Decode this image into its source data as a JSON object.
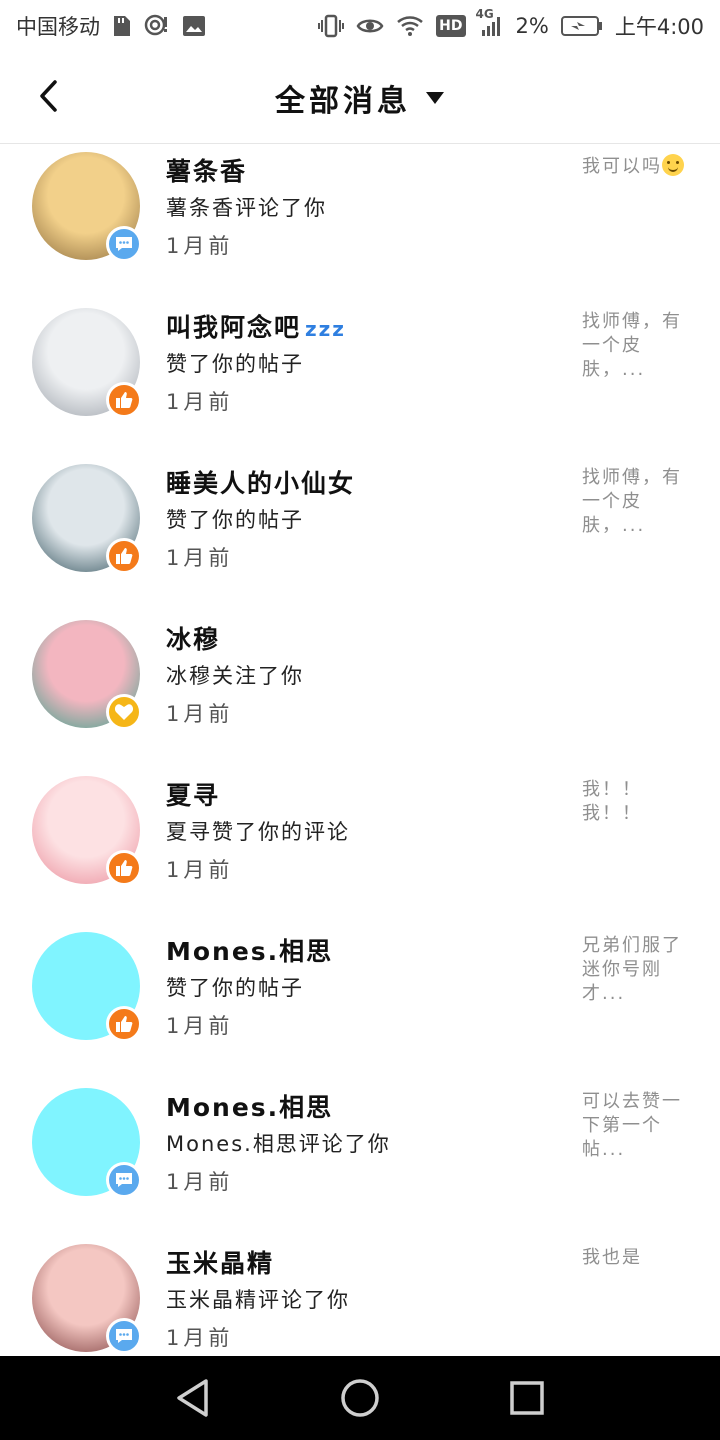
{
  "status_bar": {
    "carrier": "中国移动",
    "battery": "2%",
    "time": "上午4:00",
    "network": "4G",
    "hd": "HD",
    "icons": [
      "sim-card-icon",
      "hotspot-icon",
      "image-icon",
      "vibrate-icon",
      "eye-icon",
      "wifi-icon",
      "signal-icon",
      "battery-charging-icon"
    ]
  },
  "header": {
    "title": "全部消息",
    "back_icon": "chevron-left-icon",
    "dropdown_icon": "caret-down-icon"
  },
  "messages": [
    {
      "name": "薯条香",
      "name_suffix": "",
      "action": "薯条香评论了你",
      "time": "1月前",
      "preview": "我可以吗",
      "preview_emoji": true,
      "badge": "comment",
      "avatar_colors": [
        "#f2d08a",
        "#8a6a3a"
      ]
    },
    {
      "name": "叫我阿念吧",
      "name_suffix": "zzz",
      "action": "赞了你的帖子",
      "time": "1月前",
      "preview": "找师傅，有一个皮肤，...",
      "preview_emoji": false,
      "badge": "like",
      "avatar_colors": [
        "#eef0f2",
        "#9aa0a8"
      ]
    },
    {
      "name": "睡美人的小仙女",
      "name_suffix": "",
      "action": "赞了你的帖子",
      "time": "1月前",
      "preview": "找师傅，有一个皮肤，...",
      "preview_emoji": false,
      "badge": "like",
      "avatar_colors": [
        "#dfe6ea",
        "#2f4f5a"
      ]
    },
    {
      "name": "冰穆",
      "name_suffix": "",
      "action": "冰穆关注了你",
      "time": "1月前",
      "preview": "",
      "preview_emoji": false,
      "badge": "follow",
      "avatar_colors": [
        "#f3b6c0",
        "#3aa08a"
      ]
    },
    {
      "name": "夏寻",
      "name_suffix": "",
      "action": "夏寻赞了你的评论",
      "time": "1月前",
      "preview": "我！！我！！",
      "preview_emoji": false,
      "badge": "like",
      "avatar_colors": [
        "#fde1e3",
        "#e98a98"
      ]
    },
    {
      "name": "Mones.相思",
      "name_suffix": "",
      "action": "赞了你的帖子",
      "time": "1月前",
      "preview": "兄弟们服了迷你号刚才...",
      "preview_emoji": false,
      "badge": "like",
      "avatar_colors": [
        "#80f4ff",
        "#80f4ff"
      ]
    },
    {
      "name": "Mones.相思",
      "name_suffix": "",
      "action": "Mones.相思评论了你",
      "time": "1月前",
      "preview": "可以去赞一下第一个帖...",
      "preview_emoji": false,
      "badge": "comment",
      "avatar_colors": [
        "#80f4ff",
        "#80f4ff"
      ]
    },
    {
      "name": "玉米晶精",
      "name_suffix": "",
      "action": "玉米晶精评论了你",
      "time": "1月前",
      "preview": "我也是",
      "preview_emoji": false,
      "badge": "comment",
      "avatar_colors": [
        "#f4c7c2",
        "#7a3b3b"
      ]
    }
  ],
  "nav_bar": {
    "icons": [
      "back-triangle-icon",
      "home-circle-icon",
      "recents-square-icon"
    ]
  },
  "colors": {
    "comment_badge": "#5aa9ee",
    "like_badge": "#f47a1a",
    "follow_badge": "#f5b618",
    "preview_text": "#8f8f8f"
  }
}
